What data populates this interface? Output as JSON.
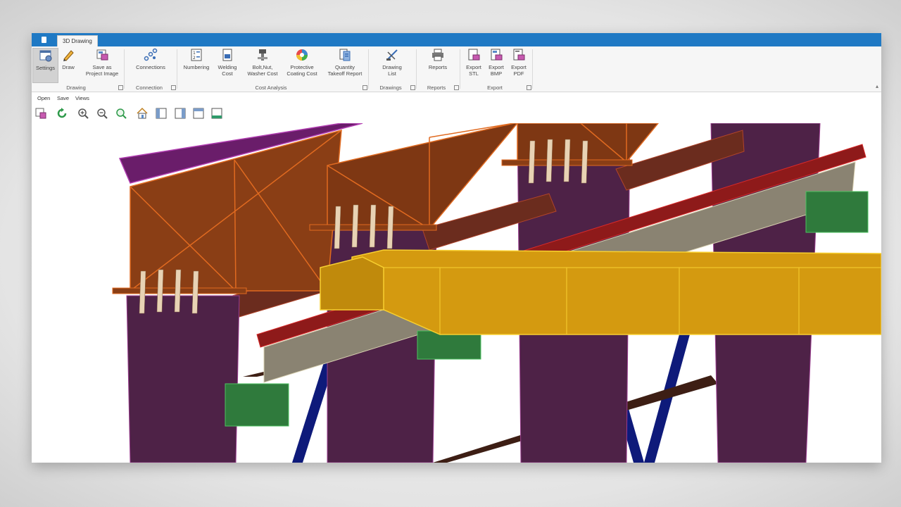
{
  "window": {
    "active_tab": "3D Drawing"
  },
  "ribbon": {
    "groups": [
      {
        "label": "Drawing"
      },
      {
        "label": "Connection"
      },
      {
        "label": "Cost Analysis"
      },
      {
        "label": "Drawings"
      },
      {
        "label": "Reports"
      },
      {
        "label": "Export"
      }
    ],
    "buttons": {
      "settings": "Settings",
      "draw": "Draw",
      "save_project_image_1": "Save as",
      "save_project_image_2": "Project Image",
      "connections": "Connections",
      "numbering": "Numbering",
      "welding_cost_1": "Welding",
      "welding_cost_2": "Cost",
      "bolt_nut_1": "Bolt,Nut,",
      "bolt_nut_2": "Washer Cost",
      "protective_1": "Protective",
      "protective_2": "Coating Cost",
      "quantity_1": "Quantity",
      "quantity_2": "Takeoff Report",
      "drawing_list_1": "Drawing",
      "drawing_list_2": "List",
      "reports": "Reports",
      "export_stl_1": "Export",
      "export_stl_2": "STL",
      "export_bmp_1": "Export",
      "export_bmp_2": "BMP",
      "export_pdf_1": "Export",
      "export_pdf_2": "PDF"
    }
  },
  "quick_menu": {
    "open": "Open",
    "save": "Save",
    "views": "Views"
  },
  "colors": {
    "titlebar": "#1f79c4",
    "column_purple": "#4e2247",
    "truss_orange": "#8a3e15",
    "beam_yellow": "#d49a10",
    "plate_green": "#2f7a3c",
    "bracing_navy": "#0e1a7a",
    "rafter_red": "#8e1a1a",
    "beam_gray": "#8a8372"
  },
  "viewport": {
    "content": "3D structural steel model"
  }
}
